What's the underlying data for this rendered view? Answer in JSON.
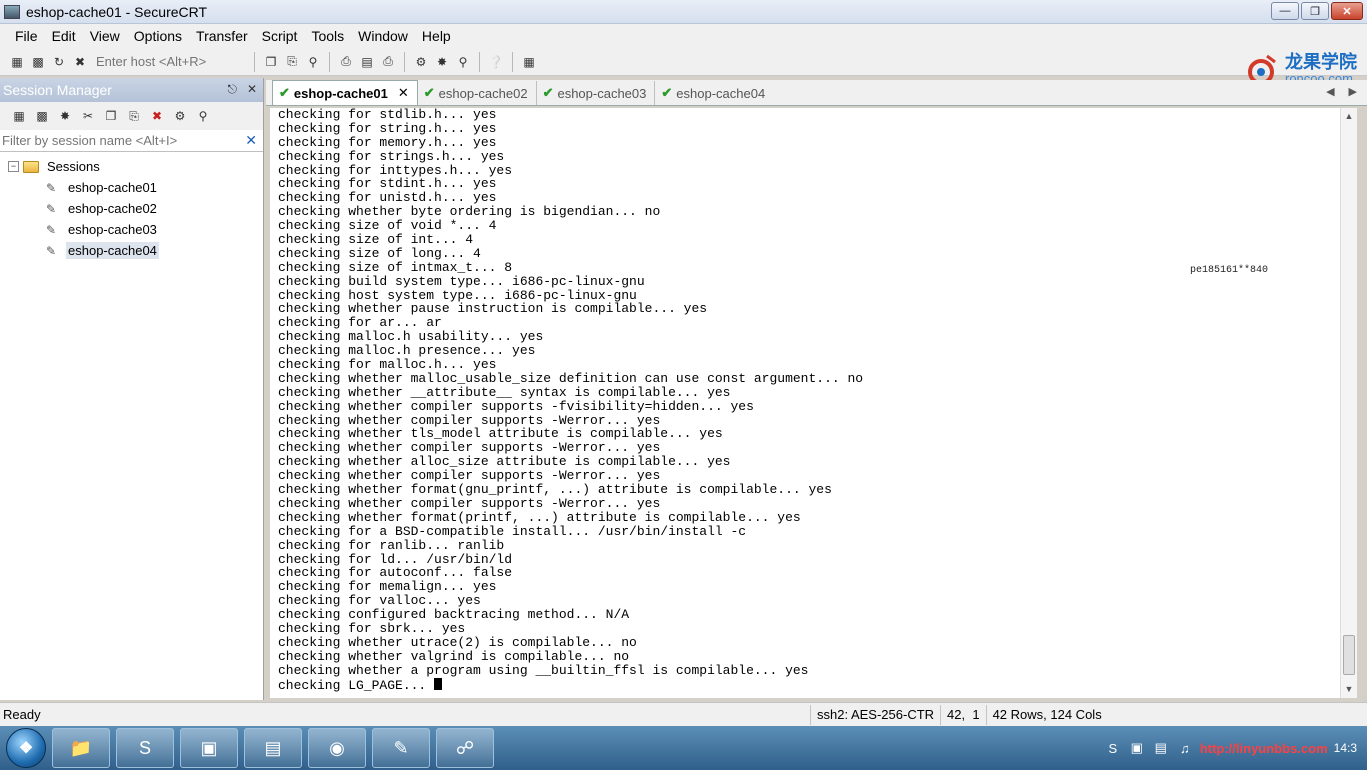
{
  "window": {
    "title": "eshop-cache01 - SecureCRT"
  },
  "menu": {
    "items": [
      "File",
      "Edit",
      "View",
      "Options",
      "Transfer",
      "Script",
      "Tools",
      "Window",
      "Help"
    ]
  },
  "toolbar": {
    "host_placeholder": "Enter host <Alt+R>"
  },
  "logo": {
    "cn": "龙果学院",
    "en": "roncoo.com"
  },
  "session_manager": {
    "title": "Session Manager",
    "filter_placeholder": "Filter by session name <Alt+I>",
    "root": "Sessions",
    "sessions": [
      "eshop-cache01",
      "eshop-cache02",
      "eshop-cache03",
      "eshop-cache04"
    ]
  },
  "tabs": [
    {
      "label": "eshop-cache01",
      "active": true
    },
    {
      "label": "eshop-cache02",
      "active": false
    },
    {
      "label": "eshop-cache03",
      "active": false
    },
    {
      "label": "eshop-cache04",
      "active": false
    }
  ],
  "terminal": {
    "lines": [
      "checking for stdlib.h... yes",
      "checking for string.h... yes",
      "checking for memory.h... yes",
      "checking for strings.h... yes",
      "checking for inttypes.h... yes",
      "checking for stdint.h... yes",
      "checking for unistd.h... yes",
      "checking whether byte ordering is bigendian... no",
      "checking size of void *... 4",
      "checking size of int... 4",
      "checking size of long... 4",
      "checking size of intmax_t... 8",
      "checking build system type... i686-pc-linux-gnu",
      "checking host system type... i686-pc-linux-gnu",
      "checking whether pause instruction is compilable... yes",
      "checking for ar... ar",
      "checking malloc.h usability... yes",
      "checking malloc.h presence... yes",
      "checking for malloc.h... yes",
      "checking whether malloc_usable_size definition can use const argument... no",
      "checking whether __attribute__ syntax is compilable... yes",
      "checking whether compiler supports -fvisibility=hidden... yes",
      "checking whether compiler supports -Werror... yes",
      "checking whether tls_model attribute is compilable... yes",
      "checking whether compiler supports -Werror... yes",
      "checking whether alloc_size attribute is compilable... yes",
      "checking whether compiler supports -Werror... yes",
      "checking whether format(gnu_printf, ...) attribute is compilable... yes",
      "checking whether compiler supports -Werror... yes",
      "checking whether format(printf, ...) attribute is compilable... yes",
      "checking for a BSD-compatible install... /usr/bin/install -c",
      "checking for ranlib... ranlib",
      "checking for ld... /usr/bin/ld",
      "checking for autoconf... false",
      "checking for memalign... yes",
      "checking for valloc... yes",
      "checking configured backtracing method... N/A",
      "checking for sbrk... yes",
      "checking whether utrace(2) is compilable... no",
      "checking whether valgrind is compilable... no",
      "checking whether a program using __builtin_ffsl is compilable... yes"
    ],
    "prompt_line": "checking LG_PAGE... ",
    "watermark": "pe185161**840"
  },
  "status": {
    "left": "Ready",
    "cipher": "ssh2: AES-256-CTR",
    "position": "42,  1",
    "size": "42 Rows, 124 Cols"
  },
  "taskbar": {
    "tray_url": "http://linyunbbs.com",
    "clock": "14:3"
  }
}
